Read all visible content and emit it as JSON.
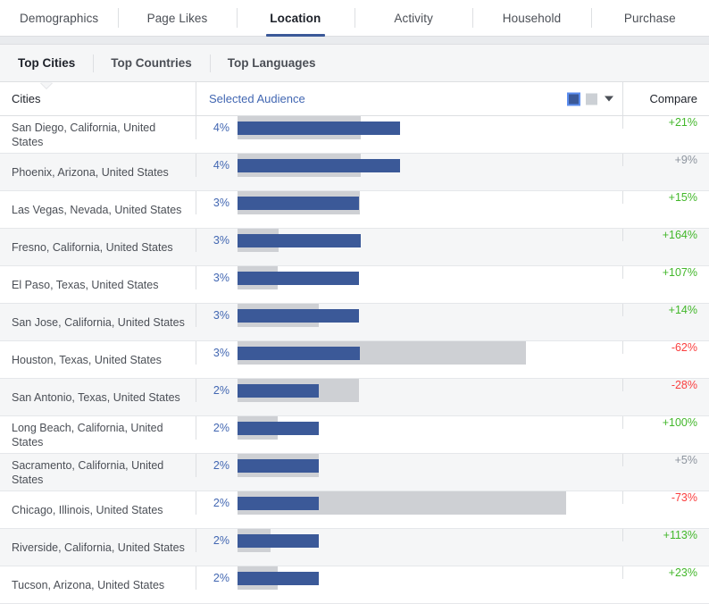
{
  "tabs": [
    {
      "label": "Demographics",
      "active": false
    },
    {
      "label": "Page Likes",
      "active": false
    },
    {
      "label": "Location",
      "active": true
    },
    {
      "label": "Activity",
      "active": false
    },
    {
      "label": "Household",
      "active": false
    },
    {
      "label": "Purchase",
      "active": false
    }
  ],
  "subtabs": [
    {
      "label": "Top Cities",
      "active": true
    },
    {
      "label": "Top Countries",
      "active": false
    },
    {
      "label": "Top Languages",
      "active": false
    }
  ],
  "table": {
    "headers": {
      "city": "Cities",
      "audience": "Selected Audience",
      "compare": "Compare"
    },
    "legend": {
      "selected_swatch": "selected-audience-swatch",
      "compare_swatch": "compare-swatch",
      "dropdown": "chevron-down-icon"
    }
  },
  "colors": {
    "selected_bar": "#3b5998",
    "compare_bar": "#ced0d4",
    "positive": "#42b72a",
    "negative": "#fa3e3e",
    "neutral": "#8d949e",
    "link": "#4267b2"
  },
  "chart_data": {
    "type": "bar",
    "title": "Top Cities",
    "xlabel": "",
    "ylabel": "Cities",
    "legend": [
      "Selected Audience",
      "Compare"
    ],
    "legend_position": "header-right",
    "grid": false,
    "categories": [
      "San Diego, California, United States",
      "Phoenix, Arizona, United States",
      "Las Vegas, Nevada, United States",
      "Fresno, California, United States",
      "El Paso, Texas, United States",
      "San Jose, California, United States",
      "Houston, Texas, United States",
      "San Antonio, Texas, United States",
      "Long Beach, California, United States",
      "Sacramento, California, United States",
      "Chicago, Illinois, United States",
      "Riverside, California, United States",
      "Tucson, Arizona, United States"
    ],
    "series": [
      {
        "name": "Selected Audience",
        "color": "#3b5998",
        "labels": [
          "4%",
          "4%",
          "3%",
          "3%",
          "3%",
          "3%",
          "3%",
          "2%",
          "2%",
          "2%",
          "2%",
          "2%",
          "2%"
        ],
        "values": [
          4.2,
          4.2,
          3.3,
          3.3,
          3.3,
          3.3,
          3.3,
          2.2,
          2.2,
          2.2,
          2.2,
          2.2,
          2.2
        ]
      },
      {
        "name": "Compare",
        "color": "#ced0d4",
        "values": [
          3.5,
          3.85,
          3.3,
          1.25,
          1.25,
          2.2,
          8.7,
          3.3,
          1.25,
          2.2,
          8.15,
          1.15,
          1.25
        ]
      }
    ],
    "compare_labels": [
      "+21%",
      "+9%",
      "+15%",
      "+164%",
      "+107%",
      "+14%",
      "-62%",
      "-28%",
      "+100%",
      "+5%",
      "-73%",
      "+113%",
      "+23%"
    ]
  },
  "rows": [
    {
      "city": "San Diego, California, United States",
      "pct": "4%",
      "blue_w": 182,
      "gray_w": 138,
      "cmp": "+21%",
      "tone": "up"
    },
    {
      "city": "Phoenix, Arizona, United States",
      "pct": "4%",
      "blue_w": 182,
      "gray_w": 138,
      "cmp": "+9%",
      "tone": "neutral"
    },
    {
      "city": "Las Vegas, Nevada, United States",
      "pct": "3%",
      "blue_w": 136,
      "gray_w": 137,
      "cmp": "+15%",
      "tone": "up"
    },
    {
      "city": "Fresno, California, United States",
      "pct": "3%",
      "blue_w": 138,
      "gray_w": 46,
      "cmp": "+164%",
      "tone": "up"
    },
    {
      "city": "El Paso, Texas, United States",
      "pct": "3%",
      "blue_w": 136,
      "gray_w": 45,
      "cmp": "+107%",
      "tone": "up"
    },
    {
      "city": "San Jose, California, United States",
      "pct": "3%",
      "blue_w": 136,
      "gray_w": 91,
      "cmp": "+14%",
      "tone": "up"
    },
    {
      "city": "Houston, Texas, United States",
      "pct": "3%",
      "blue_w": 137,
      "gray_w": 323,
      "cmp": "-62%",
      "tone": "down"
    },
    {
      "city": "San Antonio, Texas, United States",
      "pct": "2%",
      "blue_w": 91,
      "gray_w": 136,
      "cmp": "-28%",
      "tone": "down"
    },
    {
      "city": "Long Beach, California, United States",
      "pct": "2%",
      "blue_w": 91,
      "gray_w": 45,
      "cmp": "+100%",
      "tone": "up"
    },
    {
      "city": "Sacramento, California, United States",
      "pct": "2%",
      "blue_w": 91,
      "gray_w": 91,
      "cmp": "+5%",
      "tone": "neutral"
    },
    {
      "city": "Chicago, Illinois, United States",
      "pct": "2%",
      "blue_w": 91,
      "gray_w": 368,
      "cmp": "-73%",
      "tone": "down"
    },
    {
      "city": "Riverside, California, United States",
      "pct": "2%",
      "blue_w": 91,
      "gray_w": 37,
      "cmp": "+113%",
      "tone": "up"
    },
    {
      "city": "Tucson, Arizona, United States",
      "pct": "2%",
      "blue_w": 91,
      "gray_w": 45,
      "cmp": "+23%",
      "tone": "up"
    }
  ]
}
